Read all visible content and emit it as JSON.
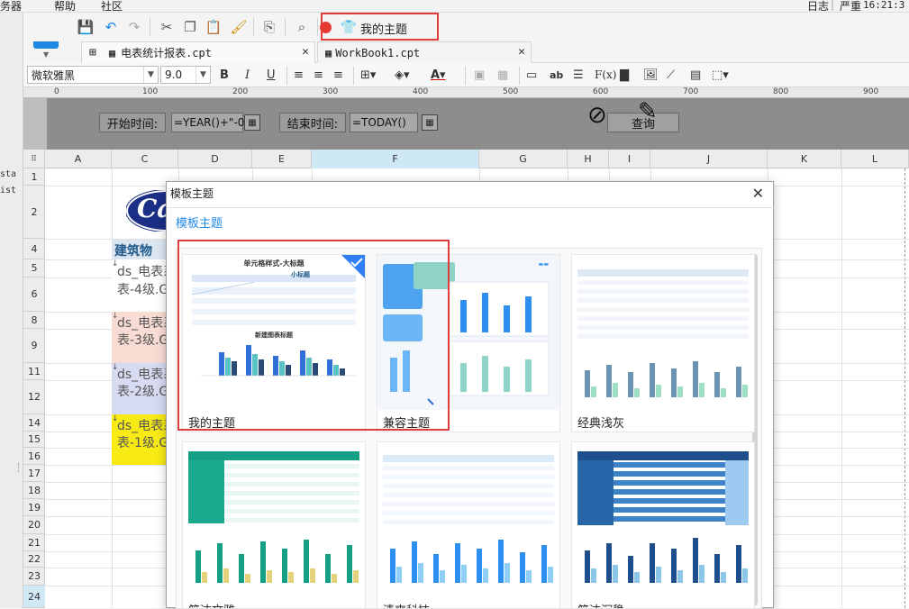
{
  "menubar": {
    "left": [
      "务器",
      "帮助",
      "社区"
    ],
    "log": "日志",
    "severity": "严重",
    "time": "16:21:3"
  },
  "leftstrip": {
    "t1": "sta",
    "t2": "ist"
  },
  "toolbar": {
    "theme_button": "我的主题"
  },
  "tabs": [
    {
      "label": "电表统计报表.cpt"
    },
    {
      "label": "WorkBook1.cpt"
    }
  ],
  "format": {
    "font": "微软雅黑",
    "size": "9.0",
    "bold": "B",
    "italic": "I",
    "underline": "U",
    "ab": "ab",
    "fx": "F(x)"
  },
  "ruler": [
    "0",
    "100",
    "200",
    "300",
    "400",
    "500",
    "600",
    "700",
    "800",
    "900"
  ],
  "params": {
    "start_label": "开始时间:",
    "start_value": "=YEAR()+\"-0",
    "end_label": "结束时间:",
    "end_value": "=TODAY()",
    "query_label": "查询"
  },
  "columns": [
    "A",
    "C",
    "D",
    "E",
    "F",
    "G",
    "H",
    "I",
    "J",
    "K",
    "L"
  ],
  "rows": [
    "1",
    "2",
    "4",
    "5",
    "6",
    "8",
    "9",
    "11",
    "12",
    "14",
    "15",
    "16",
    "17",
    "18",
    "19",
    "20",
    "21",
    "22",
    "23",
    "24"
  ],
  "cells": {
    "logo": "Ca",
    "header": "建筑物",
    "r5": "ds_电表系",
    "r6": "表-4级.G",
    "r8": "ds_电表系",
    "r9": "表-3级.G",
    "r11": "ds_电表系",
    "r12": "表-2级.G",
    "r14": "ds_电表系",
    "r15": "表-1级.G"
  },
  "modal": {
    "title": "模板主题",
    "subtitle": "模板主题",
    "cards": [
      {
        "name": "我的主题",
        "thumb_title": "单元格样式-大标题",
        "sub_title": "小标题",
        "chart_title": "新建图表标题"
      },
      {
        "name": "兼容主题"
      },
      {
        "name": "经典浅灰"
      },
      {
        "name": "简洁文雅"
      },
      {
        "name": "清爽科技"
      },
      {
        "name": "简洁沉稳"
      }
    ]
  },
  "colors": {
    "accent": "#1e88e5",
    "highlight": "#e23b3b",
    "teal": "#14a085",
    "navy": "#1f4e8c"
  }
}
